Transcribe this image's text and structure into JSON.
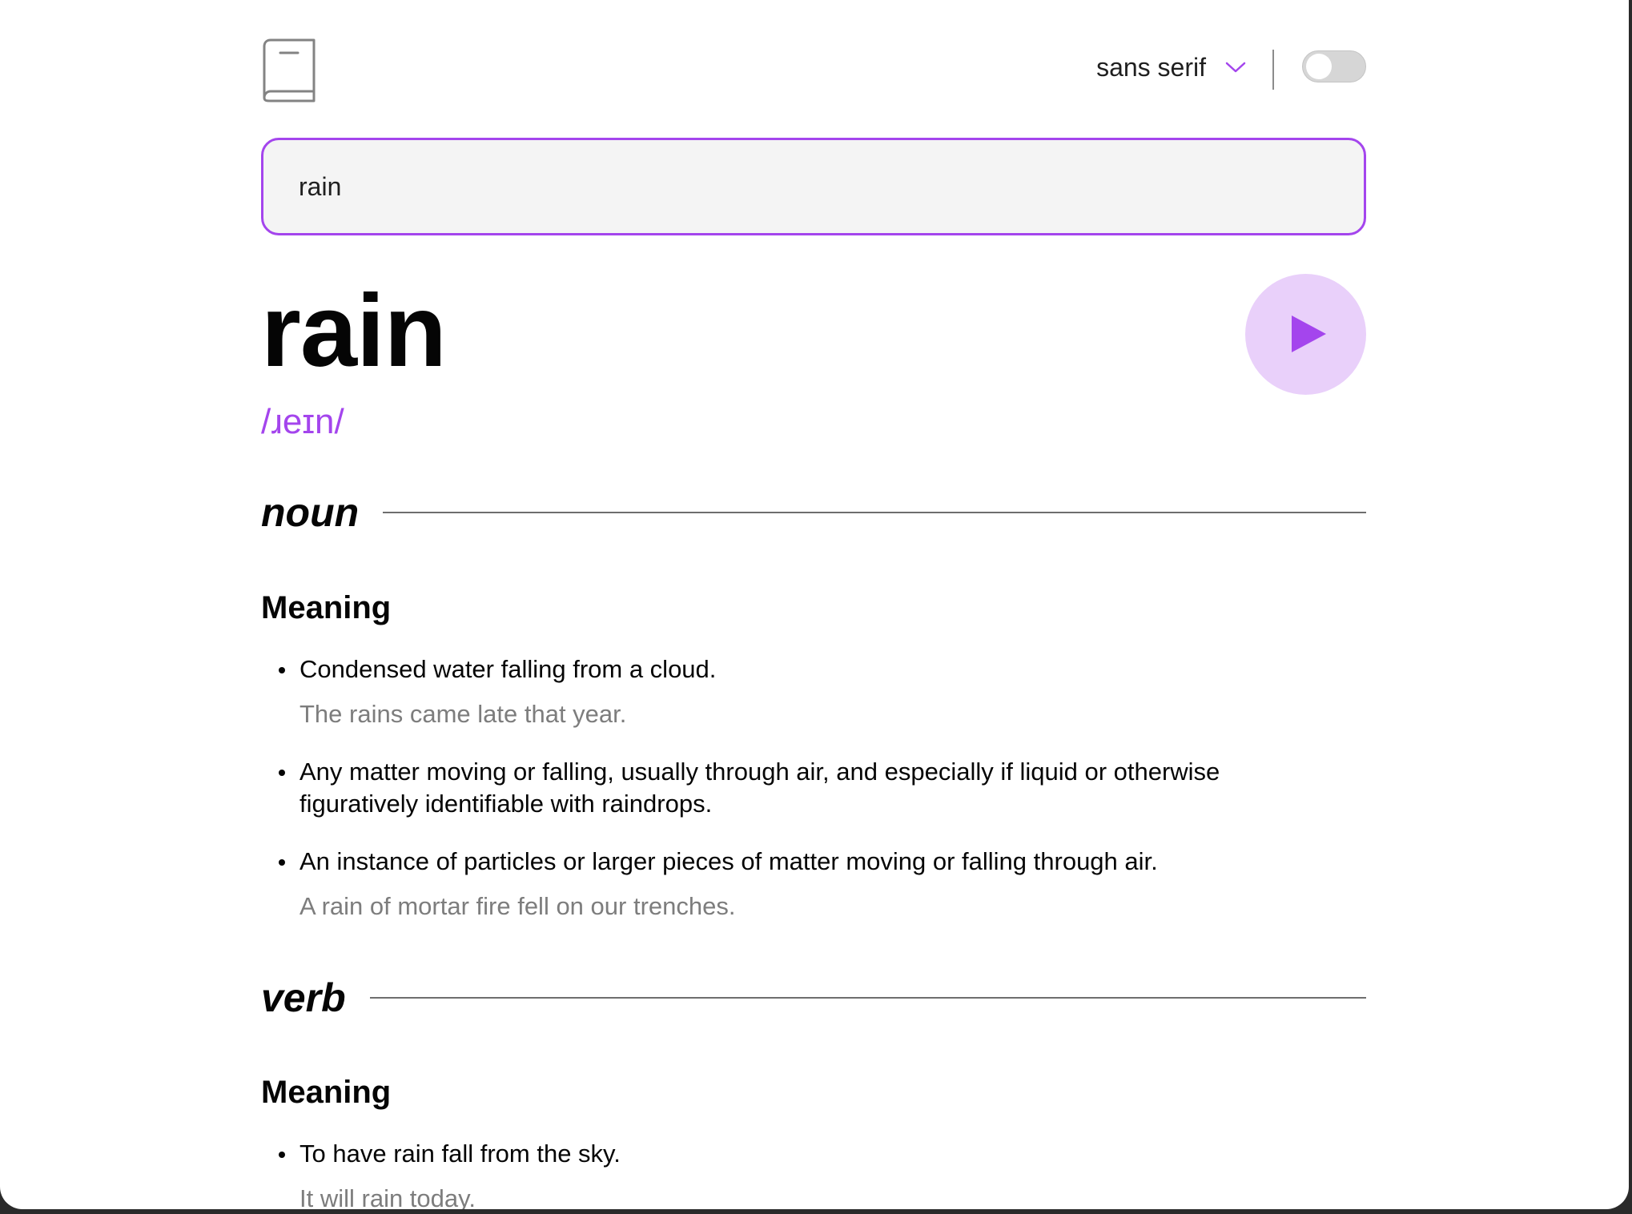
{
  "header": {
    "font_selector": "sans serif"
  },
  "search": {
    "value": "rain"
  },
  "entry": {
    "word": "rain",
    "phonetic": "/ɹeɪn/",
    "meanings": [
      {
        "part_of_speech": "noun",
        "heading": "Meaning",
        "definitions": [
          {
            "text": "Condensed water falling from a cloud.",
            "example": "The rains came late that year."
          },
          {
            "text": "Any matter moving or falling, usually through air, and especially if liquid or otherwise figuratively identifiable with raindrops.",
            "example": ""
          },
          {
            "text": "An instance of particles or larger pieces of matter moving or falling through air.",
            "example": "A rain of mortar fire fell on our trenches."
          }
        ]
      },
      {
        "part_of_speech": "verb",
        "heading": "Meaning",
        "definitions": [
          {
            "text": "To have rain fall from the sky.",
            "example": "It will rain today."
          }
        ]
      }
    ]
  },
  "colors": {
    "accent": "#a445ed",
    "accent_light": "#e9d0fa",
    "text": "#050505",
    "muted": "#7d7d7d"
  },
  "icons": {
    "logo": "book-icon",
    "dropdown": "chevron-down-icon",
    "play": "play-icon"
  },
  "toggle": {
    "dark_mode_on": false
  }
}
